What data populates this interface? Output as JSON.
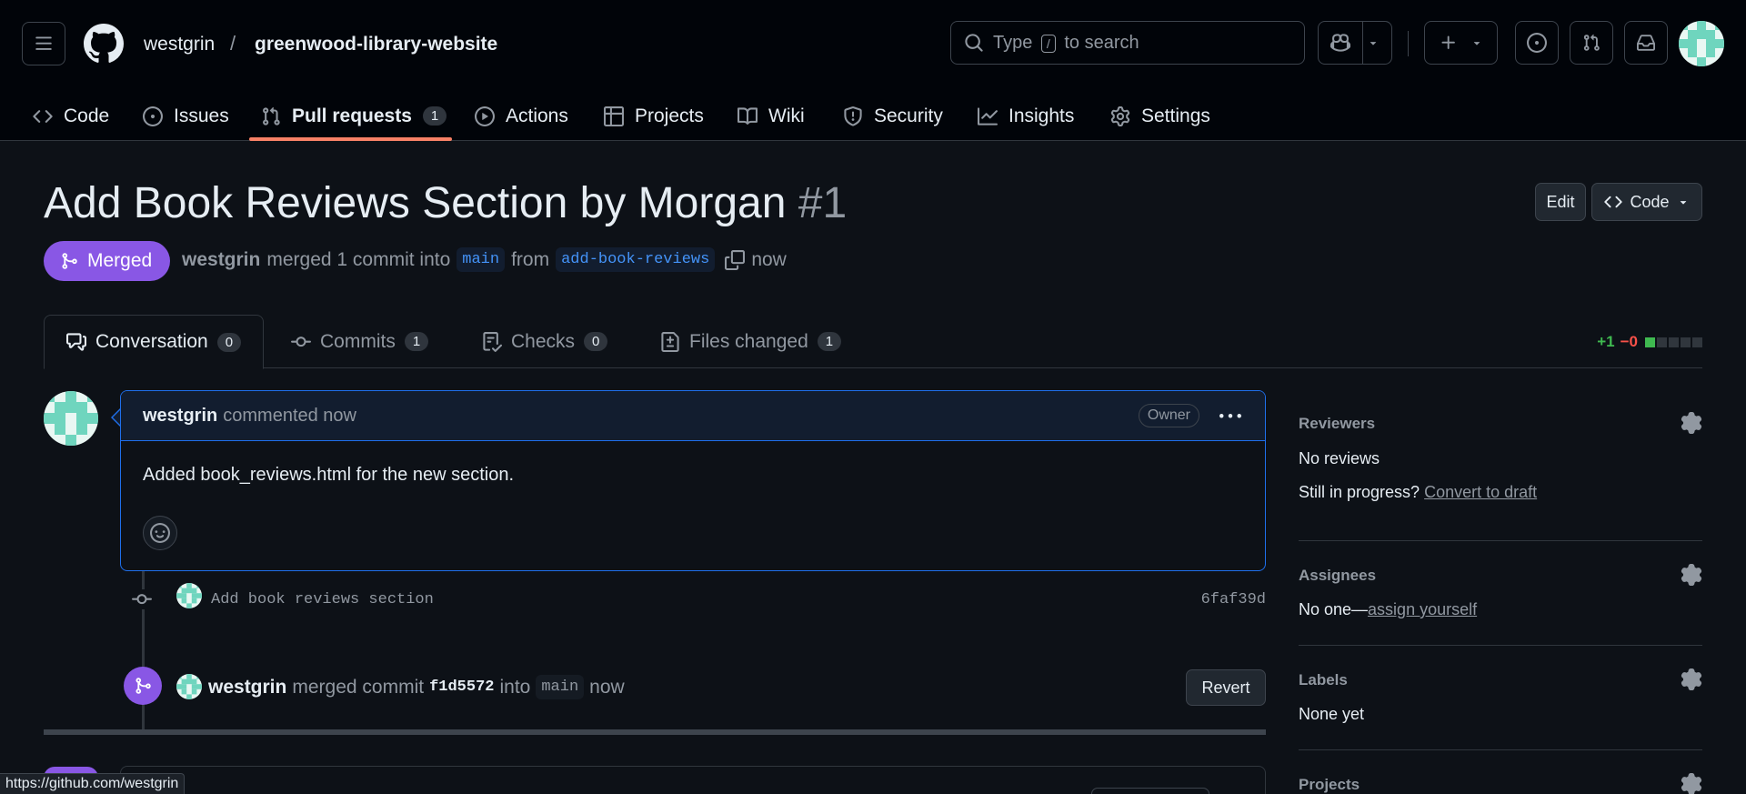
{
  "header": {
    "owner": "westgrin",
    "separator": "/",
    "repo": "greenwood-library-website",
    "search_prefix": "Type",
    "search_key": "/",
    "search_suffix": "to search"
  },
  "repo_nav": [
    {
      "label": "Code",
      "icon": "code-icon"
    },
    {
      "label": "Issues",
      "icon": "issue-opened-icon"
    },
    {
      "label": "Pull requests",
      "icon": "git-pull-request-icon",
      "count": "1",
      "active": true
    },
    {
      "label": "Actions",
      "icon": "play-icon"
    },
    {
      "label": "Projects",
      "icon": "table-icon"
    },
    {
      "label": "Wiki",
      "icon": "book-icon"
    },
    {
      "label": "Security",
      "icon": "shield-icon"
    },
    {
      "label": "Insights",
      "icon": "graph-icon"
    },
    {
      "label": "Settings",
      "icon": "gear-icon"
    }
  ],
  "pr": {
    "title": "Add Book Reviews Section by Morgan",
    "number": "#1",
    "edit_label": "Edit",
    "code_label": "Code",
    "state": "Merged",
    "author": "westgrin",
    "action_text": "merged 1 commit into",
    "base_branch": "main",
    "from_text": "from",
    "head_branch": "add-book-reviews",
    "time": "now"
  },
  "tabs": [
    {
      "label": "Conversation",
      "count": "0",
      "icon": "comment-discussion-icon",
      "active": true
    },
    {
      "label": "Commits",
      "count": "1",
      "icon": "git-commit-icon"
    },
    {
      "label": "Checks",
      "count": "0",
      "icon": "checklist-icon"
    },
    {
      "label": "Files changed",
      "count": "1",
      "icon": "file-diff-icon"
    }
  ],
  "diffstat": {
    "additions": "+1",
    "deletions": "−0",
    "blocks": [
      "add",
      "neutral",
      "neutral",
      "neutral",
      "neutral"
    ]
  },
  "comment": {
    "author": "westgrin",
    "meta": "commented now",
    "badge": "Owner",
    "body": "Added book_reviews.html for the new section."
  },
  "commit": {
    "message": "Add book reviews section",
    "sha": "6faf39d"
  },
  "merge_event": {
    "author": "westgrin",
    "text": "merged commit",
    "sha": "f1d5572",
    "into": "into",
    "branch": "main",
    "time": "now",
    "revert_label": "Revert"
  },
  "sidebar": {
    "reviewers": {
      "title": "Reviewers",
      "value": "No reviews",
      "prompt": "Still in progress?",
      "link": "Convert to draft"
    },
    "assignees": {
      "title": "Assignees",
      "value": "No one—",
      "link": "assign yourself"
    },
    "labels": {
      "title": "Labels",
      "value": "None yet"
    },
    "projects": {
      "title": "Projects"
    }
  },
  "status_bar_url": "https://github.com/westgrin",
  "colors": {
    "merged": "#8957e5",
    "link": "#4493f8",
    "add": "#3fb950",
    "delete": "#f85149",
    "underline": "#f78166"
  }
}
